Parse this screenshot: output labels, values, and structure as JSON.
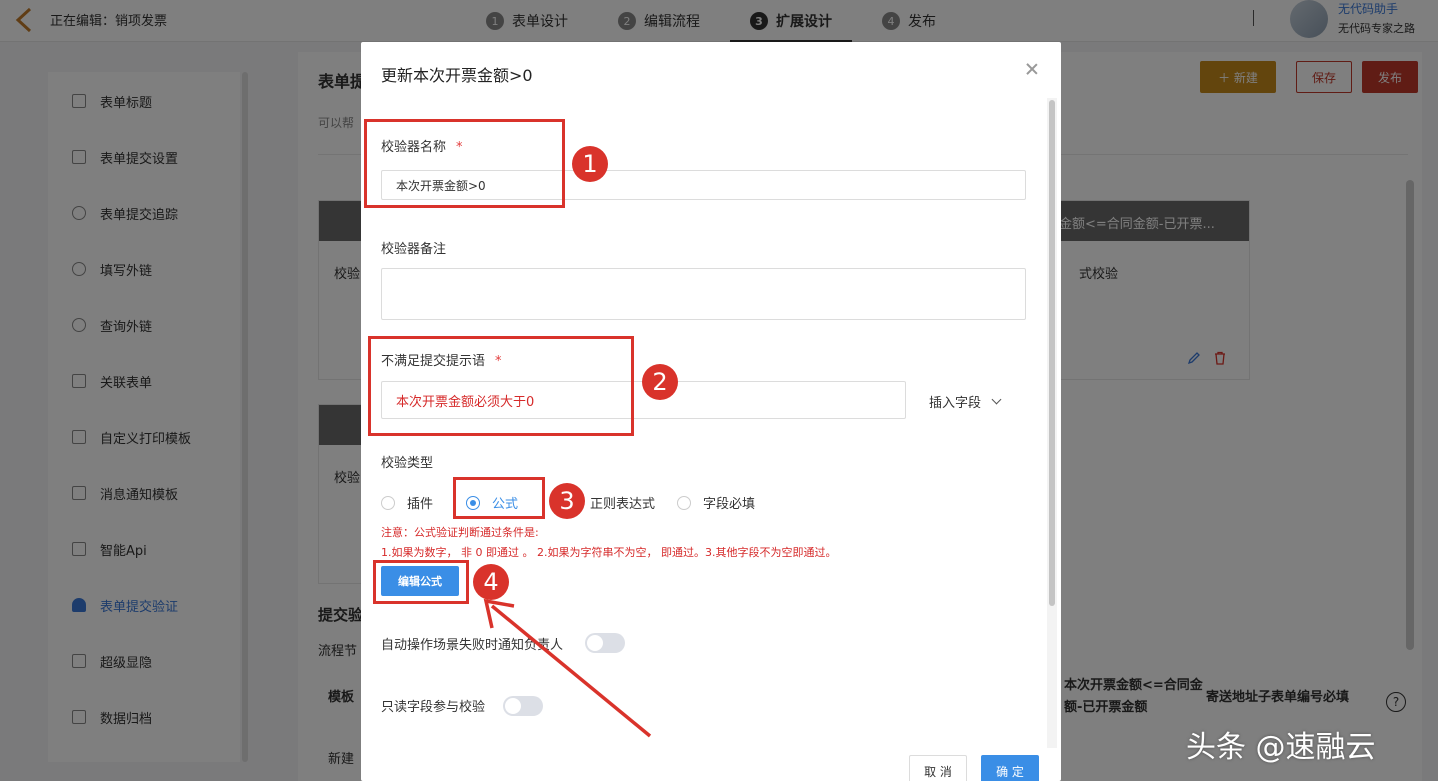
{
  "topbar": {
    "editing_label": "正在编辑：销项发票",
    "steps": [
      {
        "num": "1",
        "label": "表单设计"
      },
      {
        "num": "2",
        "label": "编辑流程"
      },
      {
        "num": "3",
        "label": "扩展设计"
      },
      {
        "num": "4",
        "label": "发布"
      }
    ],
    "user_name": "无代码助手",
    "user_subtitle": "无代码专家之路"
  },
  "sidebar": {
    "items": [
      {
        "label": "表单标题"
      },
      {
        "label": "表单提交设置"
      },
      {
        "label": "表单提交追踪"
      },
      {
        "label": "填写外链"
      },
      {
        "label": "查询外链"
      },
      {
        "label": "关联表单"
      },
      {
        "label": "自定义打印模板"
      },
      {
        "label": "消息通知模板"
      },
      {
        "label": "智能Api"
      },
      {
        "label": "表单提交验证"
      },
      {
        "label": "超级显隐"
      },
      {
        "label": "数据归档"
      }
    ]
  },
  "content": {
    "title": "表单提",
    "subtitle": "可以帮",
    "btn_new": "＋ 新建",
    "btn_save": "保存",
    "btn_publish": "发布",
    "card1_head_right": "金额<=合同金额-已开票...",
    "card1_body_left": "校验",
    "card1_body_right": "式校验",
    "card2_body_left": "校验",
    "section_title": "提交验",
    "flow_label": "流程节",
    "template_label": "模板",
    "new_label": "新建",
    "col_text1": "本次开票金额<=合同金",
    "col_text2": "额-已开票金额",
    "col_text3": "寄送地址子表单编号必填"
  },
  "modal": {
    "title": "更新本次开票金额>0",
    "name_label": "校验器名称",
    "required_mark": "*",
    "name_value": "本次开票金额>0",
    "remark_label": "校验器备注",
    "tip_label": "不满足提交提示语",
    "tip_value": "本次开票金额必须大于0",
    "insert_field": "插入字段",
    "type_label": "校验类型",
    "radio_plugin": "插件",
    "radio_formula": "公式",
    "radio_regex": "正则表达式",
    "radio_required": "字段必填",
    "note_line1": "注意：公式验证判断通过条件是:",
    "note_line2": "1.如果为数字， 非 0 即通过 。 2.如果为字符串不为空， 即通过。3.其他字段不为空即通过。",
    "edit_formula": "编辑公式",
    "auto_notify_label": "自动操作场景失败时通知负责人",
    "readonly_label": "只读字段参与校验",
    "cancel": "取 消",
    "ok": "确 定"
  },
  "annotations": {
    "n1": "1",
    "n2": "2",
    "n3": "3",
    "n4": "4",
    "color": "#d9332b"
  },
  "watermark": "头条 @速融云"
}
